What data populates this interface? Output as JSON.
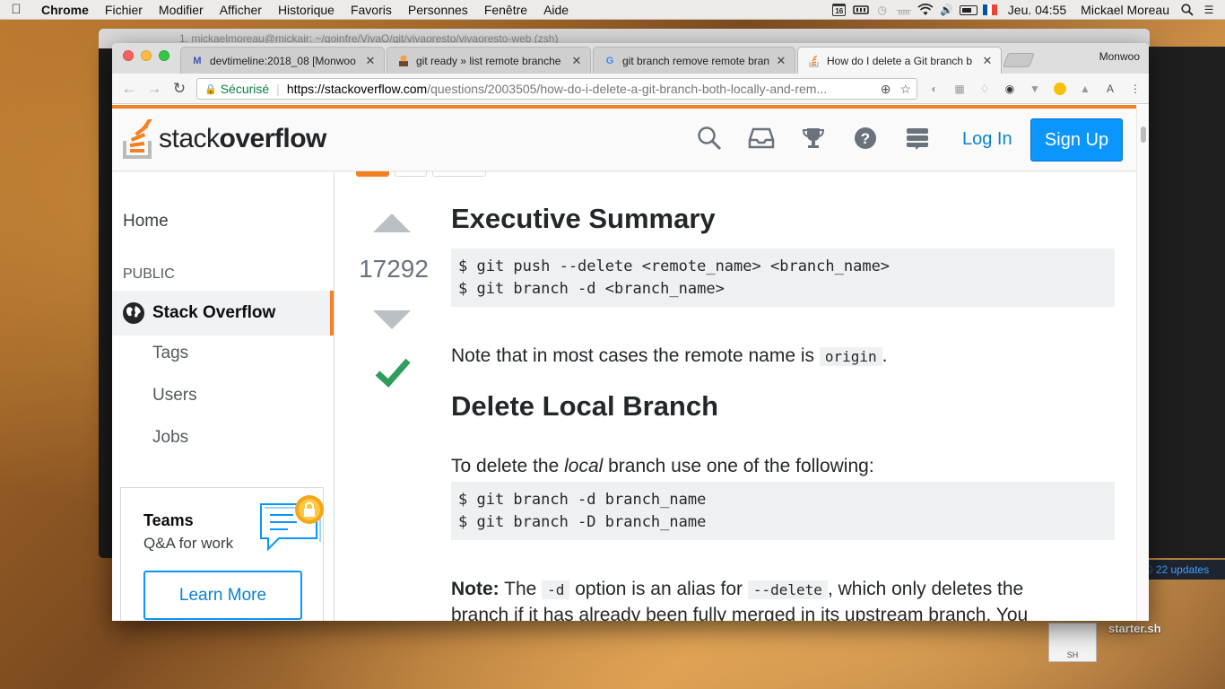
{
  "menubar": {
    "app": "Chrome",
    "items": [
      "Fichier",
      "Modifier",
      "Afficher",
      "Historique",
      "Favoris",
      "Personnes",
      "Fenêtre",
      "Aide"
    ],
    "calendar_day": "16",
    "clock": "Jeu. 04:55",
    "user": "Mickael Moreau"
  },
  "background_terminal": {
    "title": "1. mickaelmoreau@mickair: ~/goinfre/VivaO/git/vivaoresto/vivaoresto-web (zsh)",
    "updates": "22 updates"
  },
  "desktop": {
    "file_badge": "SH",
    "file_name": "starter.sh"
  },
  "browser": {
    "profile": "Monwoo",
    "tabs": [
      {
        "title": "devtimeline:2018_08 [Monwoo",
        "active": false
      },
      {
        "title": "git ready » list remote branche",
        "active": false
      },
      {
        "title": "git branch remove remote bran",
        "active": false
      },
      {
        "title": "How do I delete a Git branch b",
        "active": true
      }
    ],
    "secure_label": "Sécurisé",
    "url_host": "https://stackoverflow.com",
    "url_path": "/questions/2003505/how-do-i-delete-a-git-branch-both-locally-and-rem..."
  },
  "so": {
    "logo_light": "stack",
    "logo_bold": "overflow",
    "login": "Log In",
    "signup": "Sign Up",
    "nav": {
      "home": "Home",
      "public": "PUBLIC",
      "stackoverflow": "Stack Overflow",
      "tags": "Tags",
      "users": "Users",
      "jobs": "Jobs"
    },
    "teams": {
      "title": "Teams",
      "subtitle": "Q&A for work",
      "button": "Learn More"
    },
    "vote_count": "17292",
    "answer": {
      "h1_summary": "Executive Summary",
      "code1_line1": "$ git push --delete <remote_name> <branch_name>",
      "code1_line2": "$ git branch -d <branch_name>",
      "note_origin_pre": "Note that in most cases the remote name is ",
      "note_origin_code": "origin",
      "note_origin_post": ".",
      "h1_local": "Delete Local Branch",
      "local_pre": "To delete the ",
      "local_em": "local",
      "local_post": " branch use one of the following:",
      "code2_line1": "$ git branch -d branch_name",
      "code2_line2": "$ git branch -D branch_name",
      "note_label": "Note:",
      "note_text1": " The ",
      "note_code1": "-d",
      "note_text2": " option is an alias for ",
      "note_code2": "--delete",
      "note_text3": ", which only deletes the",
      "note_line2": "branch if it has already been fully merged in its upstream branch. You"
    }
  },
  "colors": {
    "so_orange": "#f48024",
    "so_blue": "#0a95ff",
    "accepted_green": "#2f9e5b"
  }
}
